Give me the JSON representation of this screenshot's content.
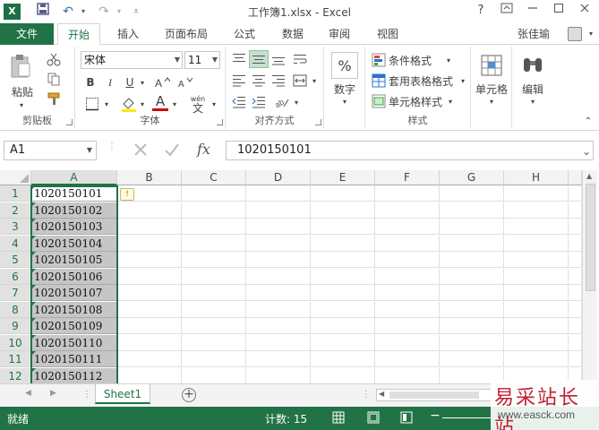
{
  "window": {
    "title": "工作簿1.xlsx - Excel",
    "app_icon": "X",
    "help": "?",
    "quick_access": {
      "save_icon": "save-icon",
      "undo": "↶",
      "redo": "↷"
    }
  },
  "tabs": {
    "file": "文件",
    "items": [
      "开始",
      "插入",
      "页面布局",
      "公式",
      "数据",
      "审阅",
      "视图"
    ],
    "active": "开始",
    "user": "张佳瑜"
  },
  "ribbon": {
    "clipboard": {
      "paste": "粘贴",
      "label": "剪贴板"
    },
    "font": {
      "name": "宋体",
      "size": "11",
      "bold": "B",
      "italic": "I",
      "underline": "U",
      "font_color": "A",
      "wen": "wén",
      "wen_char": "文",
      "label": "字体"
    },
    "alignment": {
      "label": "对齐方式"
    },
    "number": {
      "percent": "%",
      "label": "数字"
    },
    "styles": {
      "conditional": "条件格式",
      "table": "套用表格格式",
      "cell_styles": "单元格样式",
      "label": "样式"
    },
    "cells": {
      "label": "单元格"
    },
    "editing": {
      "label": "编辑"
    }
  },
  "formula_bar": {
    "name_box": "A1",
    "fx": "fx",
    "value": "1020150101"
  },
  "grid": {
    "columns": [
      "A",
      "B",
      "C",
      "D",
      "E",
      "F",
      "G",
      "H"
    ],
    "rows": [
      "1",
      "2",
      "3",
      "4",
      "5",
      "6",
      "7",
      "8",
      "9",
      "10",
      "11",
      "12"
    ],
    "values": [
      "1020150101",
      "1020150102",
      "1020150103",
      "1020150104",
      "1020150105",
      "1020150106",
      "1020150107",
      "1020150108",
      "1020150109",
      "1020150110",
      "1020150111",
      "1020150112"
    ],
    "warning": "!"
  },
  "sheets": {
    "tabs": [
      "Sheet1"
    ],
    "add": "+"
  },
  "status": {
    "ready": "就绪",
    "count": "计数: 15"
  },
  "watermark": {
    "title": "易采站长站",
    "url": "www.easck.com"
  },
  "colors": {
    "accent": "#217346",
    "selection": "#c6c6c6",
    "watermark": "#c2202f"
  }
}
